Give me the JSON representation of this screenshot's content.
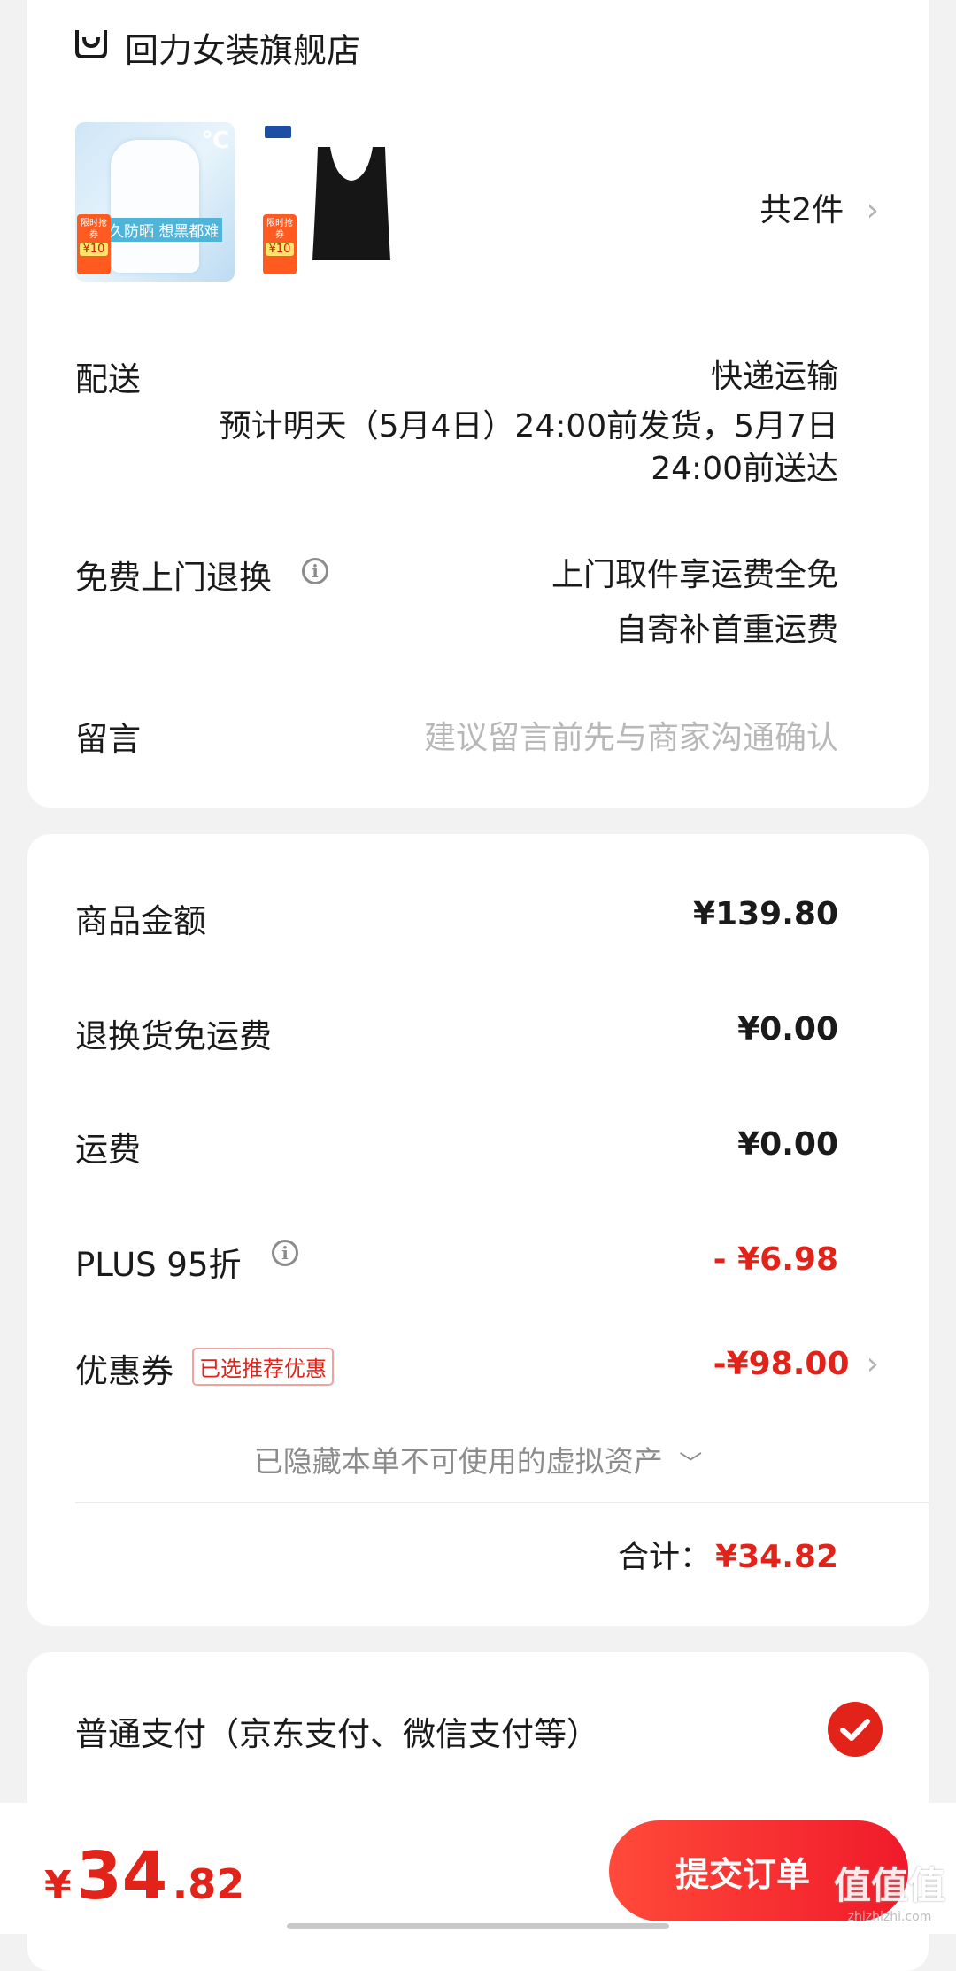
{
  "store": {
    "name": "回力女装旗舰店",
    "icon": "store-icon"
  },
  "products": {
    "thumb1": {
      "banner_text": "久防晒 想黑都难",
      "badge_top": "限时抢券",
      "badge_price": "¥10",
      "temp": "℃"
    },
    "thumb2": {
      "badge_top": "限时抢券",
      "badge_price": "¥10"
    },
    "count_label": "共2件"
  },
  "delivery": {
    "label": "配送",
    "method": "快递运输",
    "estimate_line1": "预计明天（5月4日）24:00前发货，5月7日",
    "estimate_line2": "24:00前送达"
  },
  "return_service": {
    "label": "免费上门退换",
    "line1": "上门取件享运费全免",
    "line2": "自寄补首重运费"
  },
  "message": {
    "label": "留言",
    "placeholder": "建议留言前先与商家沟通确认"
  },
  "summary": {
    "goods_label": "商品金额",
    "goods_value": "¥139.80",
    "return_ship_label": "退换货免运费",
    "return_ship_value": "¥0.00",
    "shipping_label": "运费",
    "shipping_value": "¥0.00",
    "plus_label": "PLUS 95折",
    "plus_value": "- ¥6.98",
    "coupon_label": "优惠券",
    "coupon_tag": "已选推荐优惠",
    "coupon_value": "-¥98.00",
    "hidden_assets": "已隐藏本单不可使用的虚拟资产",
    "total_label": "合计：",
    "total_value": "¥34.82"
  },
  "payment": {
    "option_label": "普通支付（京东支付、微信支付等）"
  },
  "bottom_bar": {
    "currency": "¥",
    "price_int": "34",
    "price_dec": ".82",
    "submit_label": "提交订单"
  },
  "watermark": {
    "text": "值值值",
    "url_text": "zhizhizhi.com"
  },
  "colors": {
    "accent": "#e2231a",
    "background": "#f2f2f2",
    "card": "#ffffff"
  }
}
